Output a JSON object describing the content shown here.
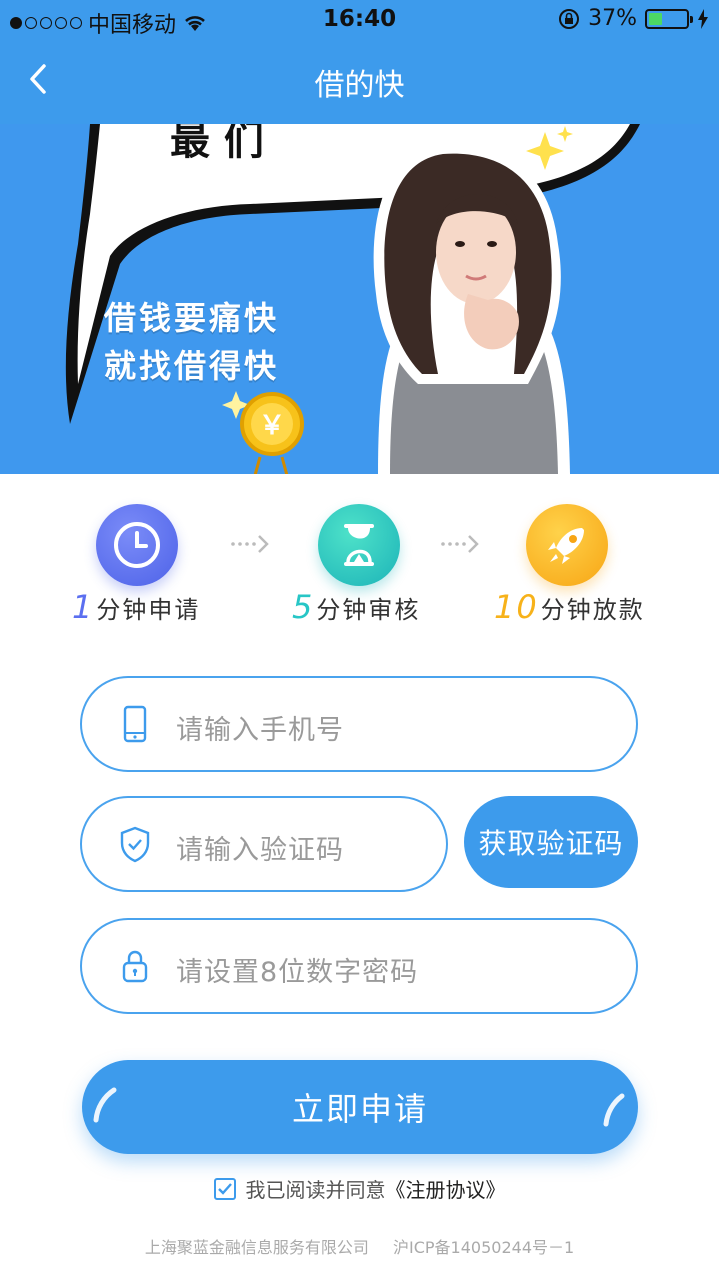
{
  "status_bar": {
    "carrier": "中国移动",
    "time": "16:40",
    "battery": "37%",
    "battery_level": 0.37
  },
  "navbar": {
    "title": "借的快"
  },
  "banner": {
    "line1": "借钱要痛快",
    "line2": "就找借得快",
    "coin_symbol": "￥"
  },
  "steps": [
    {
      "num": "1",
      "label": "分钟申请",
      "color": "#5b6ff0"
    },
    {
      "num": "5",
      "label": "分钟审核",
      "color": "#27c6c6"
    },
    {
      "num": "10",
      "label": "分钟放款",
      "color": "#f7b21a"
    }
  ],
  "form": {
    "phone_placeholder": "请输入手机号",
    "code_placeholder": "请输入验证码",
    "get_code_label": "获取验证码",
    "password_placeholder": "请设置8位数字密码"
  },
  "apply_label": "立即申请",
  "agreement": {
    "text": "我已阅读并同意",
    "link": "《注册协议》",
    "checked": true
  },
  "footer": {
    "company": "上海聚蓝金融信息服务有限公司",
    "icp": "沪ICP备14050244号－1"
  },
  "colors": {
    "primary": "#3d9bec",
    "banner": "#3f98ee"
  }
}
